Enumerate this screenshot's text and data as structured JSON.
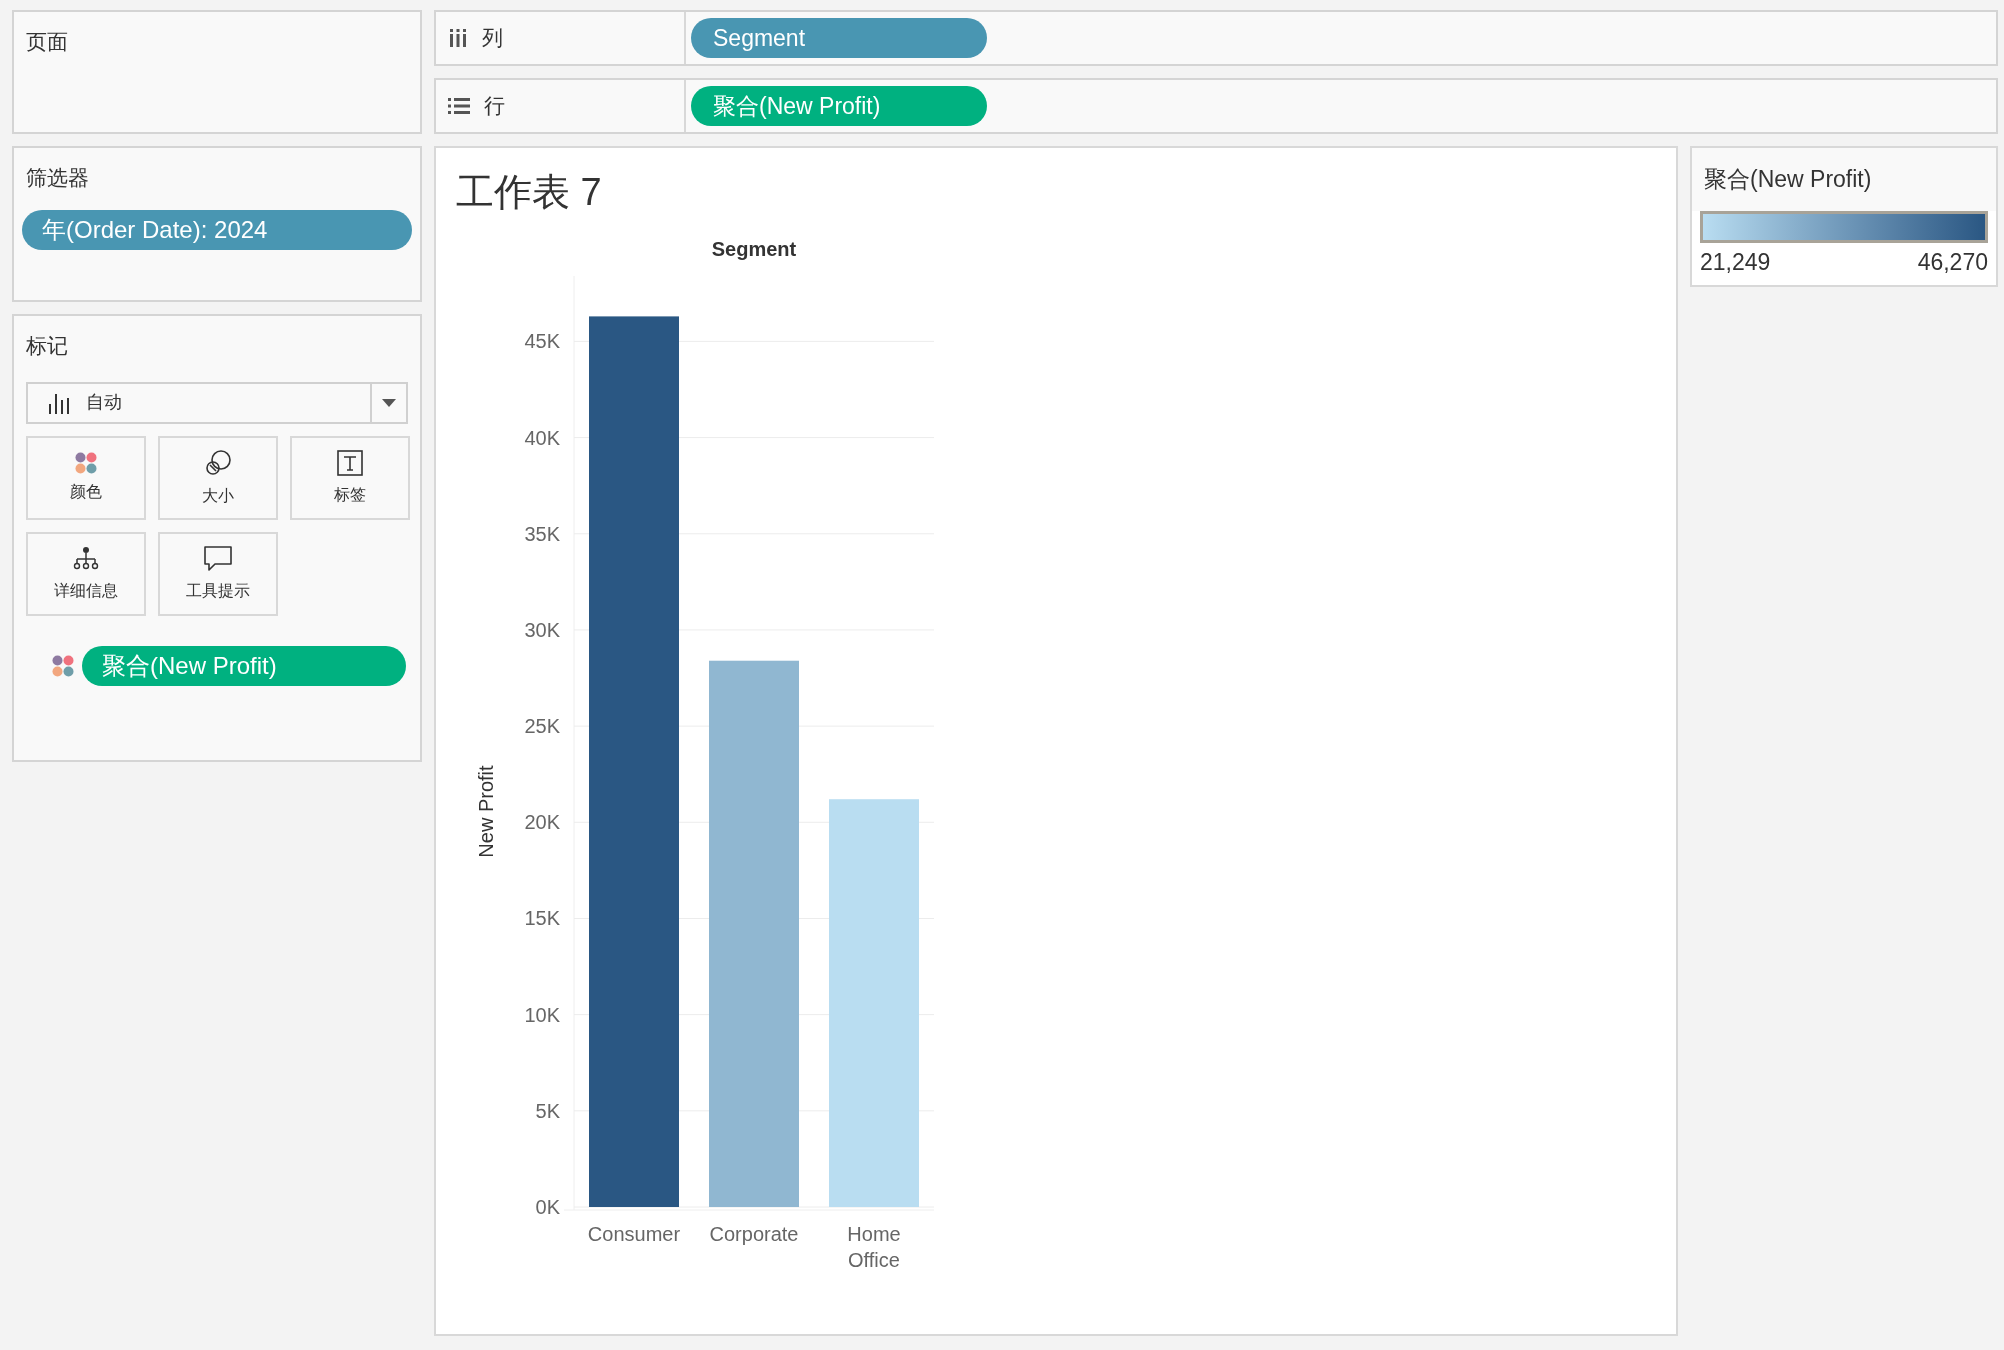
{
  "pages_panel": {
    "title": "页面"
  },
  "filters_panel": {
    "title": "筛选器",
    "pills": [
      "年(Order Date): 2024"
    ]
  },
  "marks_panel": {
    "title": "标记",
    "mark_type": "自动",
    "cards": [
      {
        "kind": "color",
        "label": "颜色"
      },
      {
        "kind": "size",
        "label": "大小"
      },
      {
        "kind": "label",
        "label": "标签"
      },
      {
        "kind": "detail",
        "label": "详细信息"
      },
      {
        "kind": "tooltip",
        "label": "工具提示"
      }
    ],
    "fields": [
      {
        "kind": "color",
        "pill": "聚合(New Profit)"
      }
    ]
  },
  "shelves": [
    {
      "kind": "columns",
      "label": "列",
      "pill": "Segment",
      "color": "#4996b2"
    },
    {
      "kind": "rows",
      "label": "行",
      "pill": "聚合(New Profit)",
      "color": "#00b180"
    }
  ],
  "worksheet": {
    "title": "工作表 7",
    "header": "Segment",
    "chart_data": {
      "type": "bar",
      "ylabel": "New Profit",
      "categories": [
        "Consumer",
        "Corporate",
        "Home Office"
      ],
      "values": [
        46300,
        28400,
        21200
      ],
      "grid": true,
      "ylim": [
        0,
        48400
      ],
      "yticks": [
        {
          "value": 0,
          "label": "0K"
        },
        {
          "value": 5000,
          "label": "5K"
        },
        {
          "value": 10000,
          "label": "10K"
        },
        {
          "value": 15000,
          "label": "15K"
        },
        {
          "value": 20000,
          "label": "20K"
        },
        {
          "value": 25000,
          "label": "25K"
        },
        {
          "value": 30000,
          "label": "30K"
        },
        {
          "value": 35000,
          "label": "35K"
        },
        {
          "value": 40000,
          "label": "40K"
        },
        {
          "value": 45000,
          "label": "45K"
        }
      ]
    }
  },
  "legend": {
    "title": "聚合(New Profit)",
    "min": "21,249",
    "max": "46,270"
  }
}
